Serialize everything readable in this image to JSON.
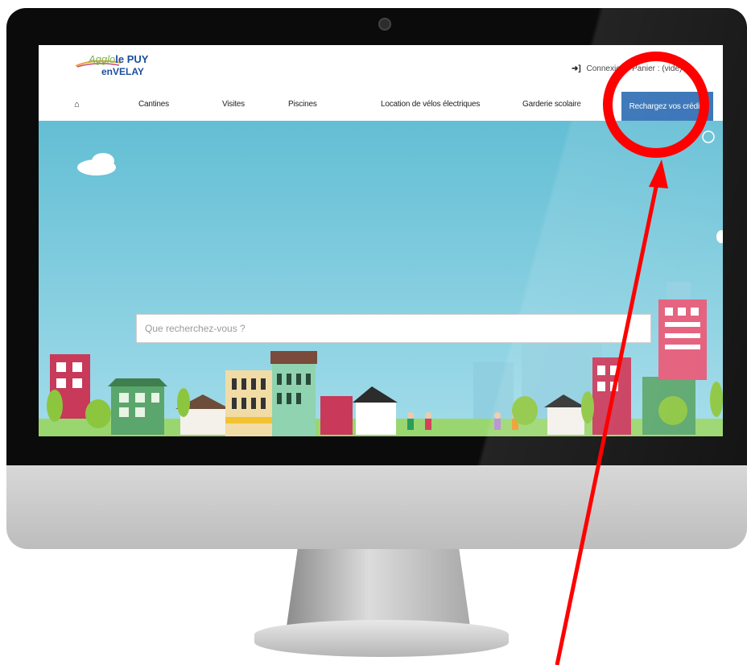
{
  "header": {
    "logo": {
      "prefix": "Agglo",
      "name": "le PUY",
      "sub": "enVELAY"
    },
    "login_label": "Connexion",
    "cart_label": "Panier : (vide)",
    "login_icon": "sign-in-icon"
  },
  "nav": {
    "home_icon": "home-icon",
    "items": [
      "Cantines",
      "Visites",
      "Piscines",
      "Location de vélos électriques",
      "Garderie scolaire"
    ],
    "cta": "Rechargez vos crédits"
  },
  "search": {
    "placeholder": "Que recherchez-vous ?"
  },
  "colors": {
    "cta_bg": "#2e6db4",
    "sky_top": "#63bed4",
    "sky_bottom": "#a2dcea",
    "annotation": "#ff0000",
    "logo_blue": "#1d4e9e",
    "logo_green": "#7ab648"
  }
}
